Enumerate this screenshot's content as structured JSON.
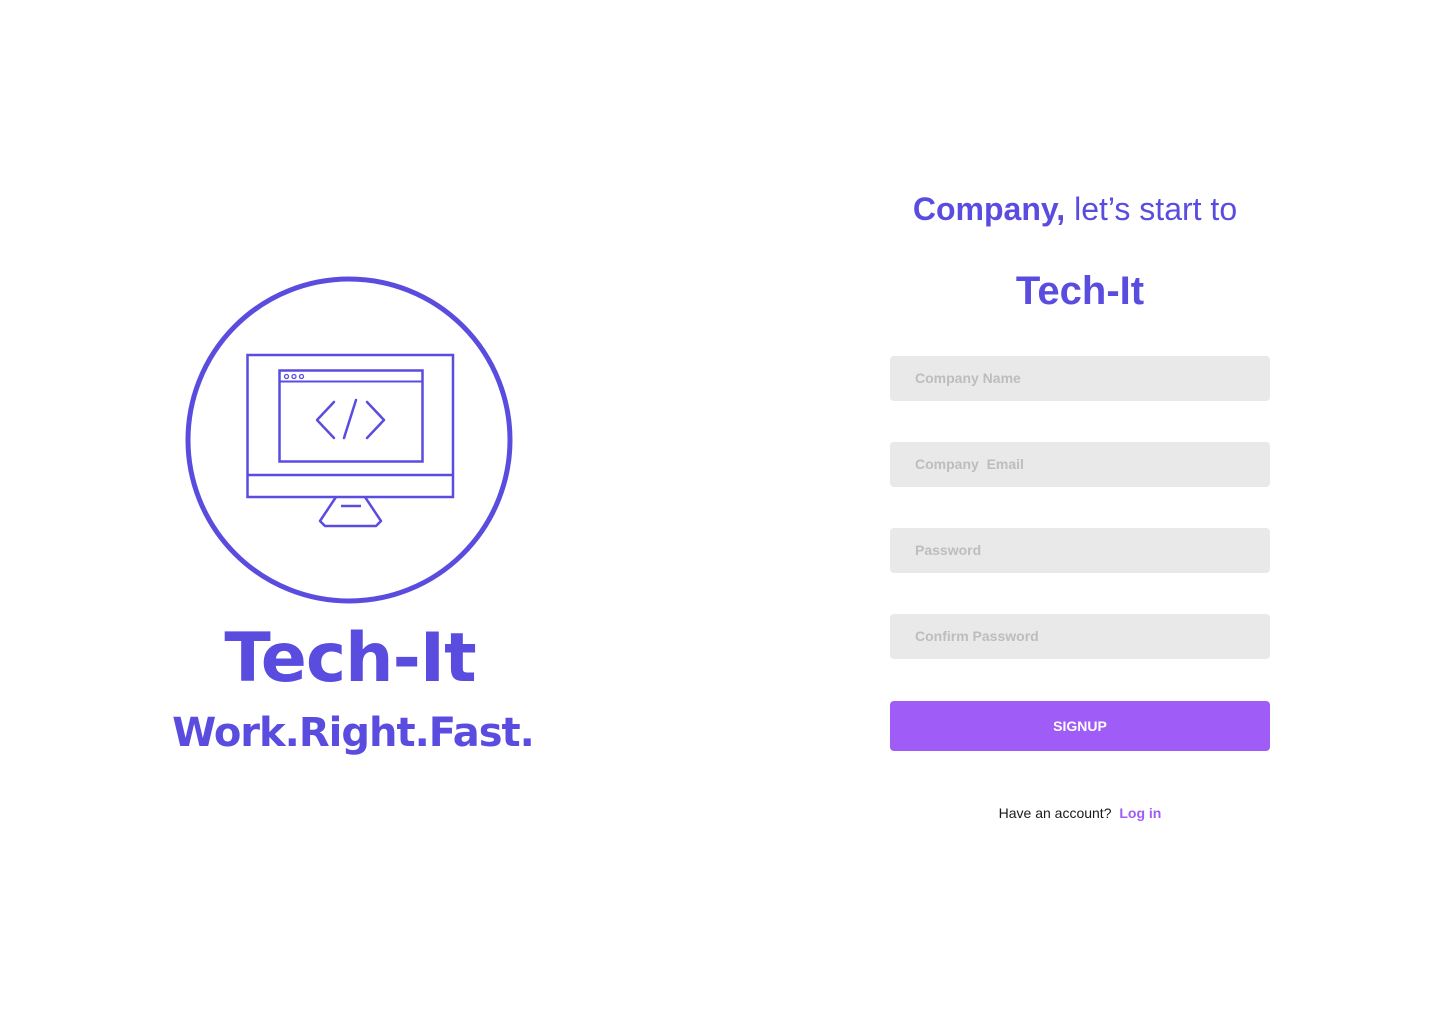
{
  "brand": {
    "name": "Tech-It",
    "tagline": "Work.Right.Fast.",
    "logo_icon": "monitor-code-icon",
    "color": "#5b4ce0"
  },
  "form": {
    "heading_bold": "Company,",
    "heading_rest": "let’s start to",
    "title": "Tech-It",
    "fields": [
      {
        "placeholder": "Company Name"
      },
      {
        "placeholder": "Company  Email"
      },
      {
        "placeholder": "Password"
      },
      {
        "placeholder": "Confirm Password"
      }
    ],
    "submit_label": "SIGNUP",
    "login_prompt": "Have an account?",
    "login_link": "Log in",
    "field_bg": "#e9e9e9",
    "button_color": "#9f5cf6"
  }
}
